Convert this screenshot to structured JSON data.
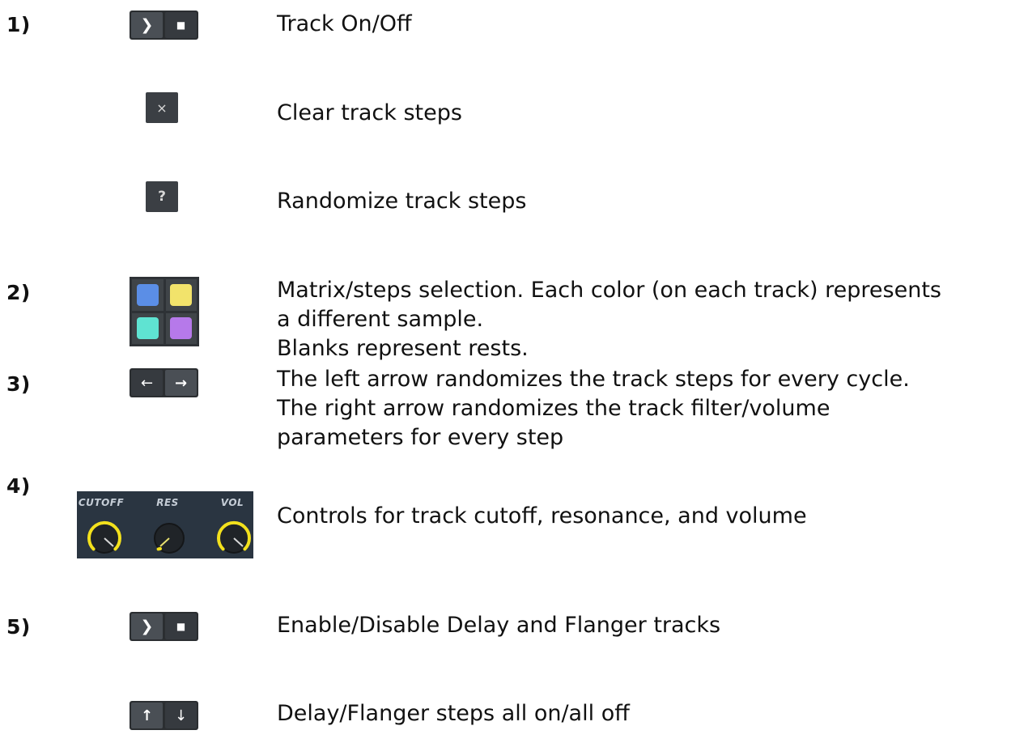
{
  "rows": [
    {
      "number": "1)",
      "text": "Track On/Off"
    },
    {
      "number": "",
      "text": "Clear track steps"
    },
    {
      "number": "",
      "text": "Randomize track steps"
    },
    {
      "number": "2)",
      "lines": [
        "Matrix/steps selection. Each color (on each track) represents",
        "a different sample.",
        "Blanks represent rests."
      ]
    },
    {
      "number": "3)",
      "lines": [
        "The left arrow randomizes the track steps for every cycle.",
        "The right arrow randomizes the track filter/volume",
        "parameters for every step"
      ]
    },
    {
      "number": "4)",
      "text": "Controls for track cutoff, resonance, and volume"
    },
    {
      "number": "5)",
      "text": "Enable/Disable Delay and Flanger tracks"
    },
    {
      "number": "",
      "text": "Delay/Flanger steps all on/all off"
    }
  ],
  "icons": {
    "play_glyph": "❯",
    "stop_glyph": "■",
    "clear_glyph": "×",
    "random_glyph": "?",
    "left_arrow": "←",
    "right_arrow": "→",
    "up_arrow": "↑",
    "down_arrow": "↓"
  },
  "matrix_colors": [
    "#5b8ee6",
    "#f2e36b",
    "#5fe3d2",
    "#b679ea"
  ],
  "knobs": {
    "labels": [
      "CUTOFF",
      "RES",
      "VOL"
    ],
    "accent_color": "#f3e11d"
  }
}
